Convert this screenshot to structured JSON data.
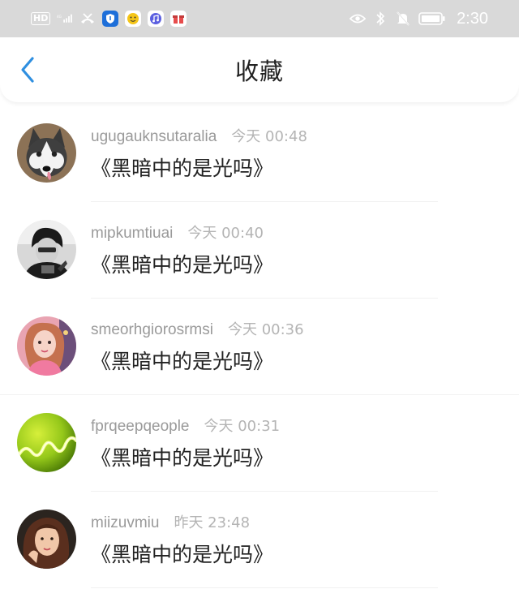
{
  "status_bar": {
    "hd": "HD",
    "network": "4G",
    "time": "2:30"
  },
  "header": {
    "title": "收藏"
  },
  "items": [
    {
      "username": "ugugauknsutaralia",
      "time": "今天 00:48",
      "content": "《黑暗中的是光吗》",
      "avatar": "husky-dog-avatar"
    },
    {
      "username": "mipkumtiuai",
      "time": "今天 00:40",
      "content": "《黑暗中的是光吗》",
      "avatar": "bw-person-avatar"
    },
    {
      "username": "smeorhgiorosrmsi",
      "time": "今天 00:36",
      "content": "《黑暗中的是光吗》",
      "avatar": "pink-girl-avatar"
    },
    {
      "username": "fprqeepqeople",
      "time": "今天 00:31",
      "content": "《黑暗中的是光吗》",
      "avatar": "green-wave-avatar"
    },
    {
      "username": "miizuvmiu",
      "time": "昨天 23:48",
      "content": "《黑暗中的是光吗》",
      "avatar": "woman-portrait-avatar"
    }
  ]
}
